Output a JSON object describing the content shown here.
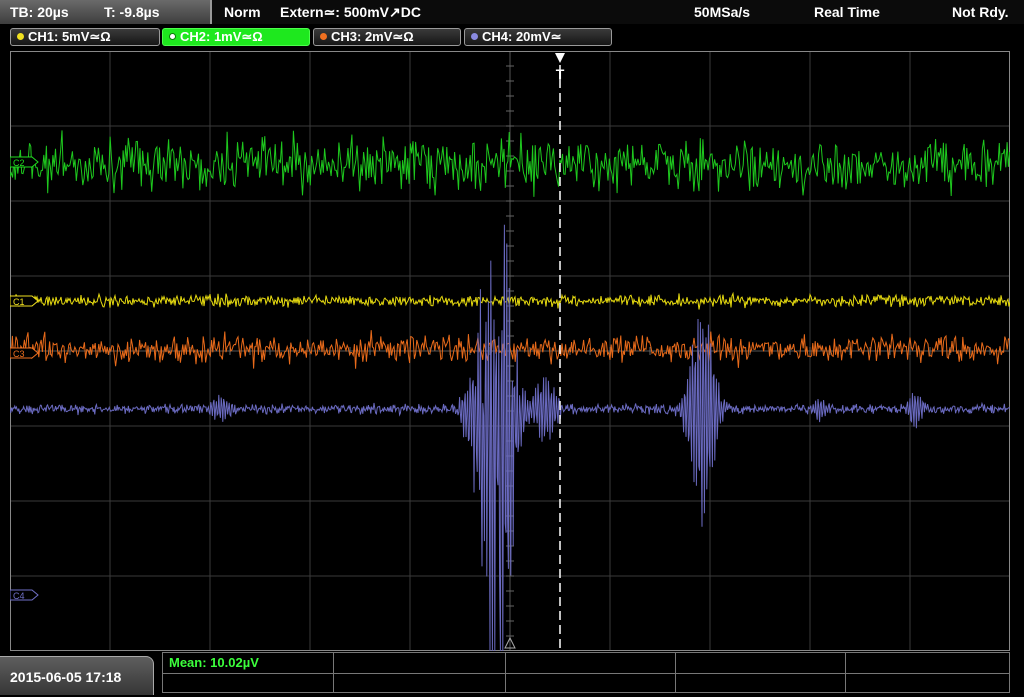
{
  "header": {
    "timebase": "TB: 20µs",
    "trigger_time": "T: -9.8µs",
    "mode": "Norm",
    "trigger_source": "Extern≃: 500mV↗DC",
    "sample_rate": "50MSa/s",
    "acq_mode": "Real Time",
    "status": "Not Rdy."
  },
  "channels": [
    {
      "label": "CH1: 5mV≃Ω",
      "color": "#f0e020",
      "marker": "C1",
      "active": false
    },
    {
      "label": "CH2: 1mV≃Ω",
      "color": "#20dd20",
      "marker": "C2",
      "active": true
    },
    {
      "label": "CH3: 2mV≃Ω",
      "color": "#f07020",
      "marker": "C3",
      "active": false
    },
    {
      "label": "CH4: 20mV≃",
      "color": "#7070c8",
      "marker": "C4",
      "active": false
    }
  ],
  "trigger_marker": "T",
  "footer": {
    "datetime": "2015-06-05 17:18",
    "measurement": "Mean: 10.02µV"
  },
  "colors": {
    "grid": "#3a3a3a",
    "ch1": "#e8dc10",
    "ch2": "#1ec81e",
    "ch3": "#e86a1a",
    "ch4": "#6a6ac0"
  }
}
